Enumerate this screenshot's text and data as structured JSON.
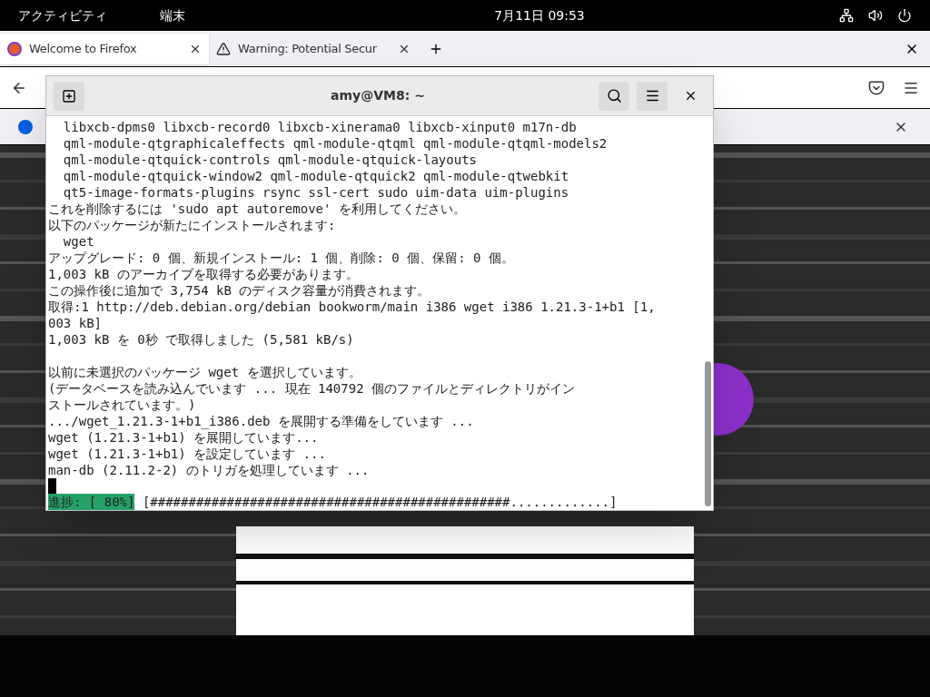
{
  "top_bar": {
    "activities": "アクティビティ",
    "app_menu": "端末",
    "clock": "7月11日 09:53"
  },
  "browser": {
    "tabs": [
      {
        "title": "Welcome to Firefox",
        "selected": true,
        "kind": "firefox"
      },
      {
        "title": "Warning: Potential Secur",
        "selected": false,
        "kind": "warning"
      }
    ]
  },
  "terminal": {
    "title": "amy@VM8: ~",
    "lines": [
      {
        "text": "  libxcb-dpms0 libxcb-record0 libxcb-xinerama0 libxcb-xinput0 m17n-db"
      },
      {
        "text": "  qml-module-qtgraphicaleffects qml-module-qtqml qml-module-qtqml-models2"
      },
      {
        "text": "  qml-module-qtquick-controls qml-module-qtquick-layouts"
      },
      {
        "text": "  qml-module-qtquick-window2 qml-module-qtquick2 qml-module-qtwebkit"
      },
      {
        "text": "  qt5-image-formats-plugins rsync ssl-cert sudo uim-data uim-plugins"
      },
      {
        "text": "これを削除するには 'sudo apt autoremove' を利用してください。"
      },
      {
        "text": "以下のパッケージが新たにインストールされます:"
      },
      {
        "text": "  wget"
      },
      {
        "text": "アップグレード: 0 個、新規インストール: 1 個、削除: 0 個、保留: 0 個。"
      },
      {
        "text": "1,003 kB のアーカイブを取得する必要があります。"
      },
      {
        "text": "この操作後に追加で 3,754 kB のディスク容量が消費されます。"
      },
      {
        "text": "取得:1 http://deb.debian.org/debian bookworm/main i386 wget i386 1.21.3-1+b1 [1,"
      },
      {
        "text": "003 kB]"
      },
      {
        "text": "1,003 kB を 0秒 で取得しました (5,581 kB/s)"
      },
      {
        "text": "以前に未選択のパッケージ wget を選択しています。",
        "gap_before": true
      },
      {
        "text": "(データベースを読み込んでいます ... 現在 140792 個のファイルとディレクトリがイン"
      },
      {
        "text": "ストールされています。)"
      },
      {
        "text": ".../wget_1.21.3-1+b1_i386.deb を展開する準備をしています ..."
      },
      {
        "text": "wget (1.21.3-1+b1) を展開しています..."
      },
      {
        "text": "wget (1.21.3-1+b1) を設定しています ..."
      },
      {
        "text": "man-db (2.11.2-2) のトリガを処理しています ..."
      }
    ],
    "progress": {
      "label": "進捗: [ 80%]",
      "bar": "[###############################################.............]"
    }
  }
}
